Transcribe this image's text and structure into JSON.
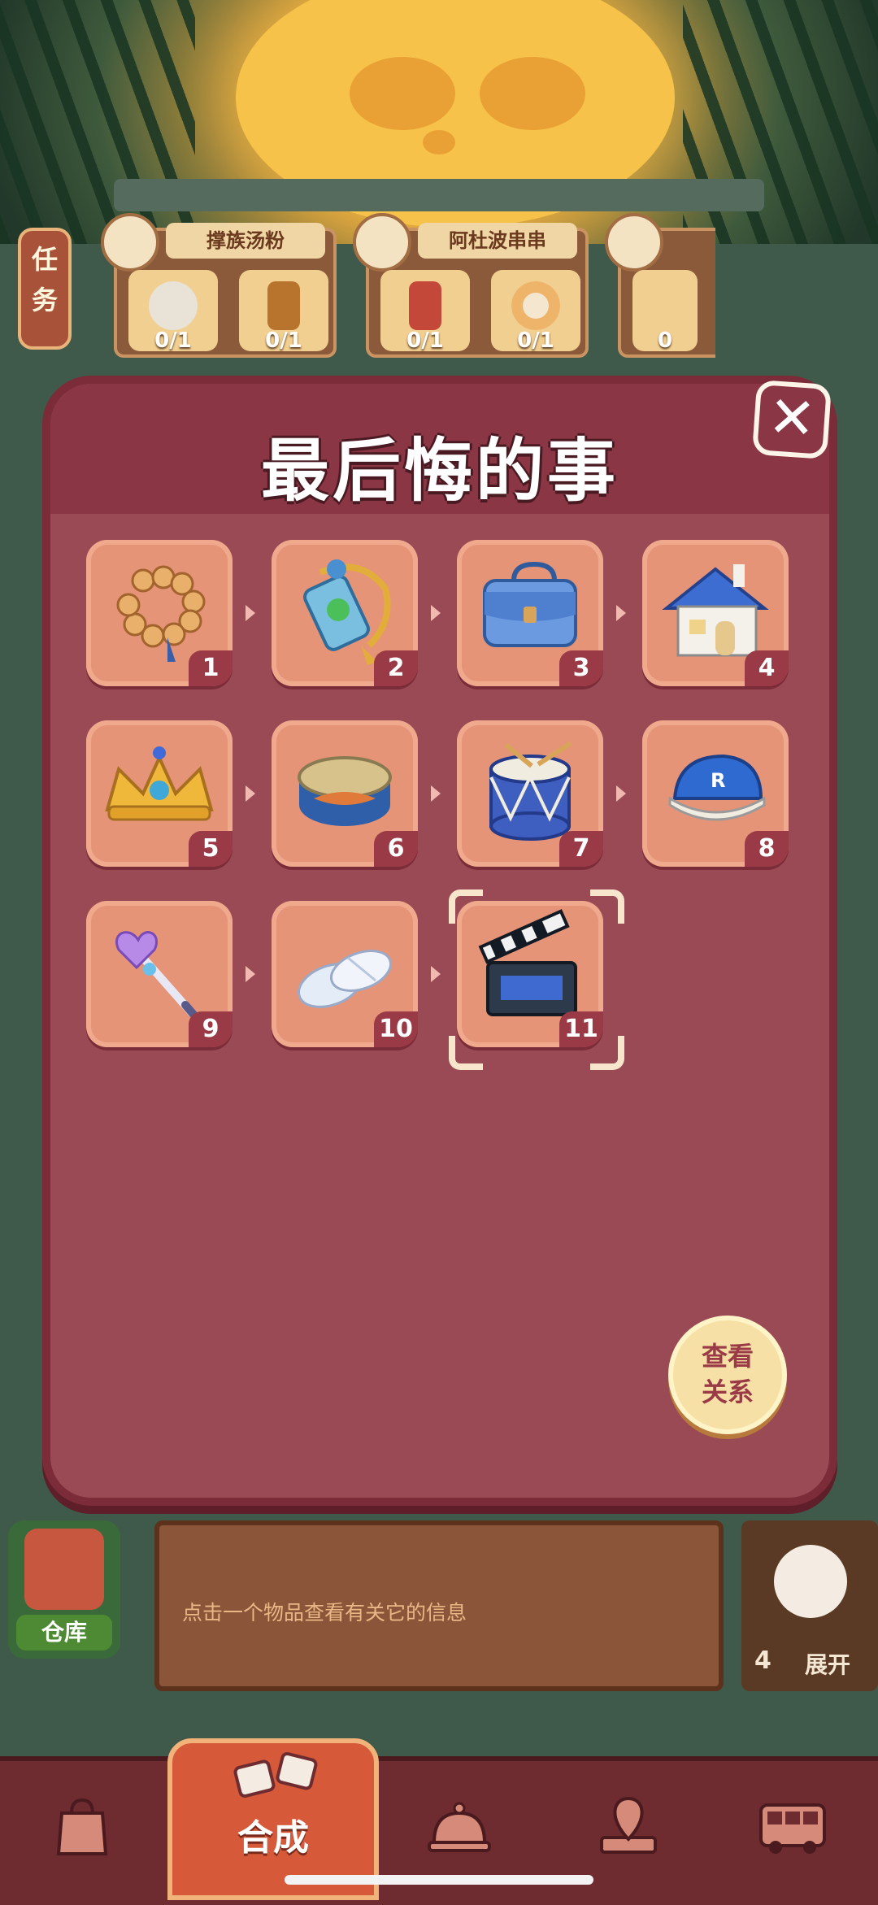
{
  "task_tab": {
    "label_top": "任",
    "label_bottom": "务"
  },
  "orders": [
    {
      "name": "撑族汤粉",
      "slots": [
        {
          "count": "0/1"
        },
        {
          "count": "0/1"
        }
      ]
    },
    {
      "name": "阿杜波串串",
      "slots": [
        {
          "count": "0/1"
        },
        {
          "count": "0/1"
        }
      ]
    }
  ],
  "partial_order": {
    "count": "0"
  },
  "modal": {
    "title": "最后悔的事",
    "close_symbol": "✕",
    "items": [
      {
        "num": "1",
        "icon": "prayer-beads-icon"
      },
      {
        "num": "2",
        "icon": "jade-pendant-icon"
      },
      {
        "num": "3",
        "icon": "blue-bag-icon"
      },
      {
        "num": "4",
        "icon": "house-icon"
      },
      {
        "num": "5",
        "icon": "crown-icon"
      },
      {
        "num": "6",
        "icon": "canned-fish-icon"
      },
      {
        "num": "7",
        "icon": "drum-icon"
      },
      {
        "num": "8",
        "icon": "baseball-cap-icon"
      },
      {
        "num": "9",
        "icon": "magic-wand-icon"
      },
      {
        "num": "10",
        "icon": "ballet-shoes-icon"
      },
      {
        "num": "11",
        "icon": "clapperboard-icon"
      }
    ],
    "selected_item": "11",
    "view_relation_line1": "查看",
    "view_relation_line2": "关系"
  },
  "warehouse": {
    "label": "仓库"
  },
  "info": {
    "hint": "点击一个物品查看有关它的信息"
  },
  "cat_panel": {
    "count": "4",
    "expand_label": "展开"
  },
  "nav": {
    "items": [
      "shop-bag-icon",
      "merge-icon",
      "service-bell-icon",
      "map-pin-icon",
      "bus-icon"
    ],
    "active_label": "合成"
  },
  "colors": {
    "modal_bg": "#9a4a54",
    "cell_bg": "#e59478",
    "accent": "#7c2c38"
  }
}
